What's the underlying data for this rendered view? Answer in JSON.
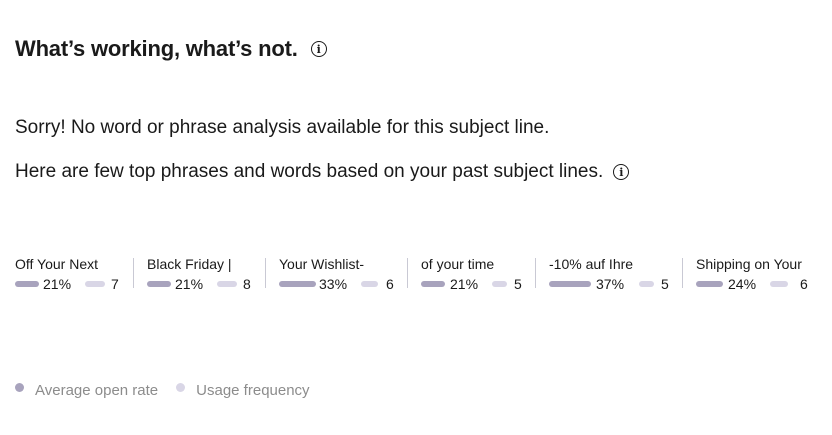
{
  "header": {
    "title": "What’s working, what’s not.",
    "info_icon": "info-circle-icon"
  },
  "messages": {
    "no_analysis": "Sorry! No word or phrase analysis available for this subject line.",
    "top_phrases": "Here are few top phrases and words based on your past subject lines."
  },
  "colors": {
    "open_rate": "#a8a3bd",
    "usage": "#d9d6e6"
  },
  "phrases": [
    {
      "label": "Off Your Next",
      "open_rate": "21%",
      "usage": "7"
    },
    {
      "label": "Black Friday |",
      "open_rate": "21%",
      "usage": "8"
    },
    {
      "label": "Your Wishlist-",
      "open_rate": "33%",
      "usage": "6"
    },
    {
      "label": "of your time",
      "open_rate": "21%",
      "usage": "5"
    },
    {
      "label": "-10% auf Ihre",
      "open_rate": "37%",
      "usage": "5"
    },
    {
      "label": "Shipping on Your",
      "open_rate": "24%",
      "usage": "6"
    }
  ],
  "legend": {
    "open_rate": "Average open rate",
    "usage": "Usage frequency"
  }
}
